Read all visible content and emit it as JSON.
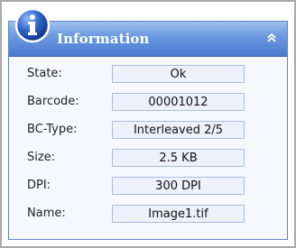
{
  "panel": {
    "title": "Information",
    "info_icon": "info-icon",
    "collapse_icon": "double-chevron-up-icon"
  },
  "fields": [
    {
      "label": "State:",
      "value": "Ok"
    },
    {
      "label": "Barcode:",
      "value": "00001012"
    },
    {
      "label": "BC-Type:",
      "value": "Interleaved 2/5"
    },
    {
      "label": "Size:",
      "value": "2.5 KB"
    },
    {
      "label": "DPI:",
      "value": "300 DPI"
    },
    {
      "label": "Name:",
      "value": "Image1.tif"
    }
  ],
  "colors": {
    "header_top": "#9ec0f0",
    "header_bottom": "#4b7ad3",
    "panel_bg": "#f6f8fd",
    "value_bg": "#ecf1fb",
    "value_border": "#a9bcdf"
  }
}
